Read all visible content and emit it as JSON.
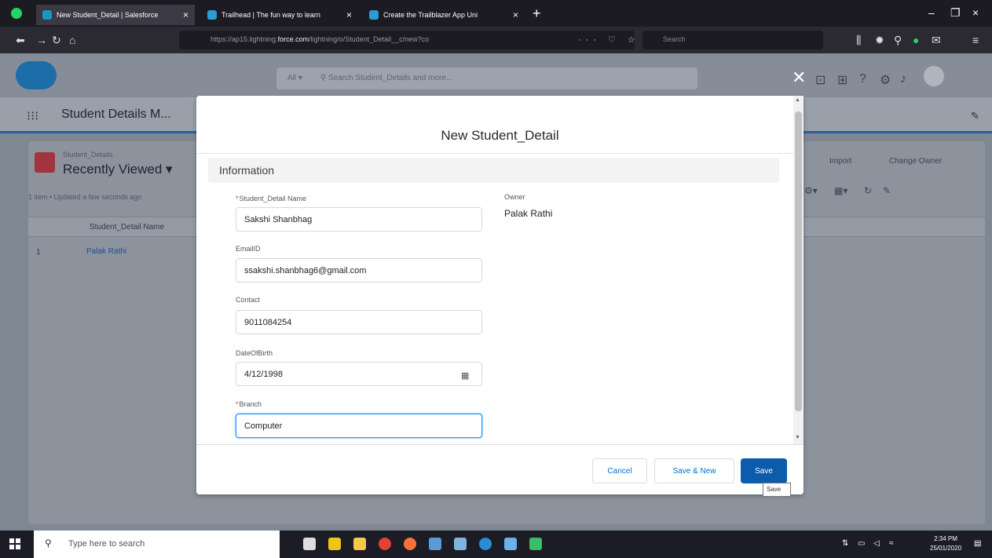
{
  "browser": {
    "tabs": [
      {
        "label": "New Student_Detail | Salesforce",
        "active": true
      },
      {
        "label": "Trailhead | The fun way to learn",
        "active": false
      },
      {
        "label": "Create the Trailblazer App Uni",
        "active": false
      }
    ],
    "url_prefix": "https://ap15.lightning.",
    "url_domain": "force.com",
    "url_suffix": "/lightning/o/Student_Detail__c/new?co",
    "search_placeholder": "Search"
  },
  "salesforce": {
    "search_scope": "All",
    "search_placeholder": "Search Student_Details and more...",
    "app_name": "Student Details M...",
    "list_view": {
      "object_label": "Student_Details",
      "title": "Recently Viewed",
      "meta": "1 item • Updated a few seconds ago",
      "column_header": "Student_Detail Name",
      "rows": [
        {
          "num": "1",
          "name": "Palak Rathi"
        }
      ],
      "actions": [
        "Import",
        "Change Owner"
      ]
    }
  },
  "modal": {
    "title": "New Student_Detail",
    "section": "Information",
    "fields": {
      "name": {
        "label": "Student_Detail Name",
        "required": "*",
        "value": "Sakshi Shanbhag"
      },
      "email": {
        "label": "EmailID",
        "value": "ssakshi.shanbhag6@gmail.com"
      },
      "contact": {
        "label": "Contact",
        "value": "9011084254"
      },
      "dob": {
        "label": "DateOfBirth",
        "value": "4/12/1998"
      },
      "branch": {
        "label": "Branch",
        "required": "*",
        "value": "Computer"
      }
    },
    "owner": {
      "label": "Owner",
      "value": "Palak Rathi"
    },
    "buttons": {
      "cancel": "Cancel",
      "save_new": "Save & New",
      "save": "Save"
    },
    "tooltip": "Save"
  },
  "taskbar": {
    "search_placeholder": "Type here to search",
    "time": "2:34 PM",
    "date": "25/01/2020"
  }
}
